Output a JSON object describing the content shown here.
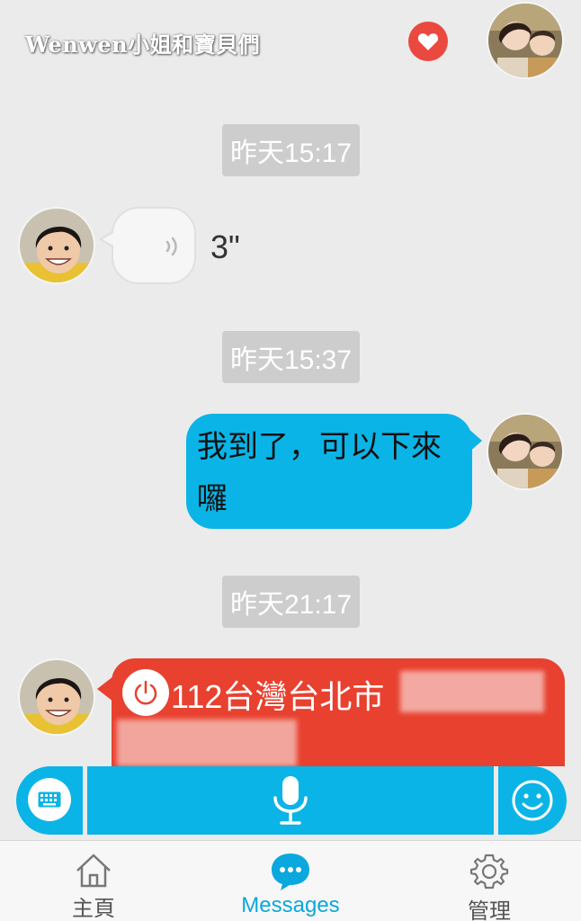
{
  "watermark": "Wenwen小姐和寶貝們",
  "messages": {
    "times": [
      "昨天15:17",
      "昨天15:37",
      "昨天21:17"
    ],
    "voice_duration": "3\"",
    "outgoing_text": "我到了，可以下來囉",
    "location_text": "112台灣台北市"
  },
  "tabs": [
    {
      "label": "主頁",
      "icon": "home-icon"
    },
    {
      "label": "Messages",
      "icon": "chat-bubble-icon"
    },
    {
      "label": "管理",
      "icon": "gear-icon"
    }
  ],
  "colors": {
    "accent_blue": "#0bb4e6",
    "location_red": "#e8412f",
    "heart_red": "#ea4940",
    "time_chip_gray": "#cdcdcd",
    "background": "#ebebeb"
  },
  "icons": {
    "heart": "heart-icon",
    "voice": "sound-wave-icon",
    "power": "power-icon",
    "keyboard": "keyboard-icon",
    "mic": "microphone-icon",
    "emoji": "smiley-icon"
  }
}
